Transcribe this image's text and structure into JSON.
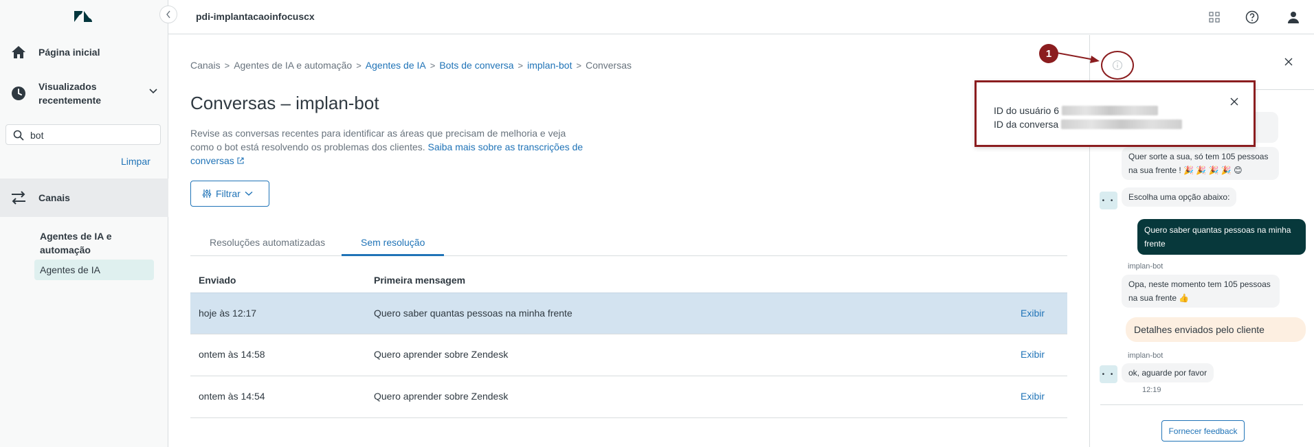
{
  "sidebar": {
    "home_label": "Página inicial",
    "recent_label": "Visualizados recentemente",
    "search_value": "bot",
    "clear_label": "Limpar",
    "channels_label": "Canais",
    "subsection_heading": "Agentes de IA e automação",
    "subsection_item": "Agentes de IA"
  },
  "topbar": {
    "workspace": "pdi-implantacaoinfocuscx"
  },
  "breadcrumb": {
    "items": [
      "Canais",
      "Agentes de IA e automação",
      "Agentes de IA",
      "Bots de conversa",
      "implan-bot",
      "Conversas"
    ]
  },
  "page": {
    "title": "Conversas – implan-bot",
    "description": "Revise as conversas recentes para identificar as áreas que precisam de melhoria e veja como o bot está resolvendo os problemas dos clientes. ",
    "learn_more": "Saiba mais sobre as transcrições de conversas",
    "filter_label": "Filtrar"
  },
  "tabs": {
    "automated": "Resoluções automatizadas",
    "unresolved": "Sem resolução"
  },
  "table": {
    "headers": {
      "sent": "Enviado",
      "first_message": "Primeira mensagem"
    },
    "rows": [
      {
        "sent": "hoje às 12:17",
        "message": "Quero saber quantas pessoas na minha frente",
        "action": "Exibir"
      },
      {
        "sent": "ontem às 14:58",
        "message": "Quero aprender sobre Zendesk",
        "action": "Exibir"
      },
      {
        "sent": "ontem às 14:54",
        "message": "Quero aprender sobre Zendesk",
        "action": "Exibir"
      }
    ]
  },
  "popover": {
    "user_id_label": "ID do usuário",
    "user_id_prefix": "6",
    "conversation_id_label": "ID da conversa"
  },
  "callout": {
    "number": "1"
  },
  "chat": {
    "msg1": "Quer sorte a sua, só tem 105 pessoas na sua frente !  🎉 🎉 🎉 🎉 😊",
    "msg2": "Escolha uma opção abaixo:",
    "user_msg": "Quero saber quantas pessoas na minha frente",
    "sender1": "implan-bot",
    "msg3": "Opa, neste momento tem 105 pessoas na sua frente 👍",
    "note": "Detalhes enviados pelo cliente",
    "sender2": "implan-bot",
    "msg4": "ok, aguarde por favor",
    "time": "12:19",
    "feedback_label": "Fornecer feedback"
  },
  "colors": {
    "accent": "#1f73b7",
    "highlight_border": "#8b1d1f",
    "selected_row": "#d3e3f0",
    "user_bubble": "#07383b"
  },
  "icons": [
    "zendesk-logo",
    "chevron-left-icon",
    "home-icon",
    "history-icon",
    "chevron-down-icon",
    "search-icon",
    "arrows-swap-icon",
    "grid-icon",
    "help-icon",
    "user-icon",
    "external-link-icon",
    "filter-icon",
    "info-icon",
    "close-icon"
  ]
}
